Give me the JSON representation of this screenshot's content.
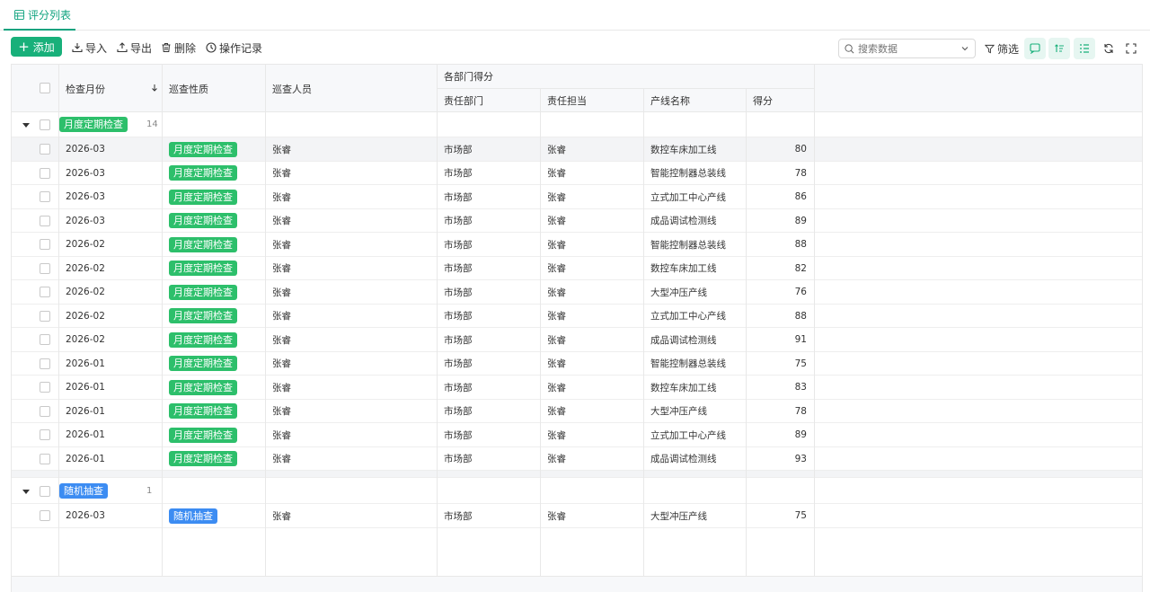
{
  "tab": {
    "label": "评分列表"
  },
  "toolbar": {
    "add": "添加",
    "import": "导入",
    "export": "导出",
    "delete": "删除",
    "log": "操作记录",
    "search_placeholder": "搜索数据",
    "filter": "筛选"
  },
  "columns": {
    "month": "检查月份",
    "nature": "巡查性质",
    "person": "巡查人员",
    "group_header": "各部门得分",
    "dept": "责任部门",
    "owner": "责任担当",
    "line": "产线名称",
    "score": "得分"
  },
  "groups": [
    {
      "label": "月度定期检查",
      "count": "14",
      "color": "#2dbf6b",
      "rows": [
        {
          "month": "2026-03",
          "nature": "月度定期检查",
          "person": "张睿",
          "dept": "市场部",
          "owner": "张睿",
          "line": "数控车床加工线",
          "score": "80"
        },
        {
          "month": "2026-03",
          "nature": "月度定期检查",
          "person": "张睿",
          "dept": "市场部",
          "owner": "张睿",
          "line": "智能控制器总装线",
          "score": "78"
        },
        {
          "month": "2026-03",
          "nature": "月度定期检查",
          "person": "张睿",
          "dept": "市场部",
          "owner": "张睿",
          "line": "立式加工中心产线",
          "score": "86"
        },
        {
          "month": "2026-03",
          "nature": "月度定期检查",
          "person": "张睿",
          "dept": "市场部",
          "owner": "张睿",
          "line": "成品调试检测线",
          "score": "89"
        },
        {
          "month": "2026-02",
          "nature": "月度定期检查",
          "person": "张睿",
          "dept": "市场部",
          "owner": "张睿",
          "line": "智能控制器总装线",
          "score": "88"
        },
        {
          "month": "2026-02",
          "nature": "月度定期检查",
          "person": "张睿",
          "dept": "市场部",
          "owner": "张睿",
          "line": "数控车床加工线",
          "score": "82"
        },
        {
          "month": "2026-02",
          "nature": "月度定期检查",
          "person": "张睿",
          "dept": "市场部",
          "owner": "张睿",
          "line": "大型冲压产线",
          "score": "76"
        },
        {
          "month": "2026-02",
          "nature": "月度定期检查",
          "person": "张睿",
          "dept": "市场部",
          "owner": "张睿",
          "line": "立式加工中心产线",
          "score": "88"
        },
        {
          "month": "2026-02",
          "nature": "月度定期检查",
          "person": "张睿",
          "dept": "市场部",
          "owner": "张睿",
          "line": "成品调试检测线",
          "score": "91"
        },
        {
          "month": "2026-01",
          "nature": "月度定期检查",
          "person": "张睿",
          "dept": "市场部",
          "owner": "张睿",
          "line": "智能控制器总装线",
          "score": "75"
        },
        {
          "month": "2026-01",
          "nature": "月度定期检查",
          "person": "张睿",
          "dept": "市场部",
          "owner": "张睿",
          "line": "数控车床加工线",
          "score": "83"
        },
        {
          "month": "2026-01",
          "nature": "月度定期检查",
          "person": "张睿",
          "dept": "市场部",
          "owner": "张睿",
          "line": "大型冲压产线",
          "score": "78"
        },
        {
          "month": "2026-01",
          "nature": "月度定期检查",
          "person": "张睿",
          "dept": "市场部",
          "owner": "张睿",
          "line": "立式加工中心产线",
          "score": "89"
        },
        {
          "month": "2026-01",
          "nature": "月度定期检查",
          "person": "张睿",
          "dept": "市场部",
          "owner": "张睿",
          "line": "成品调试检测线",
          "score": "93"
        }
      ]
    },
    {
      "label": "随机抽查",
      "count": "1",
      "color": "#3c8cf2",
      "rows": [
        {
          "month": "2026-03",
          "nature": "随机抽查",
          "person": "张睿",
          "dept": "市场部",
          "owner": "张睿",
          "line": "大型冲压产线",
          "score": "75"
        }
      ]
    }
  ]
}
